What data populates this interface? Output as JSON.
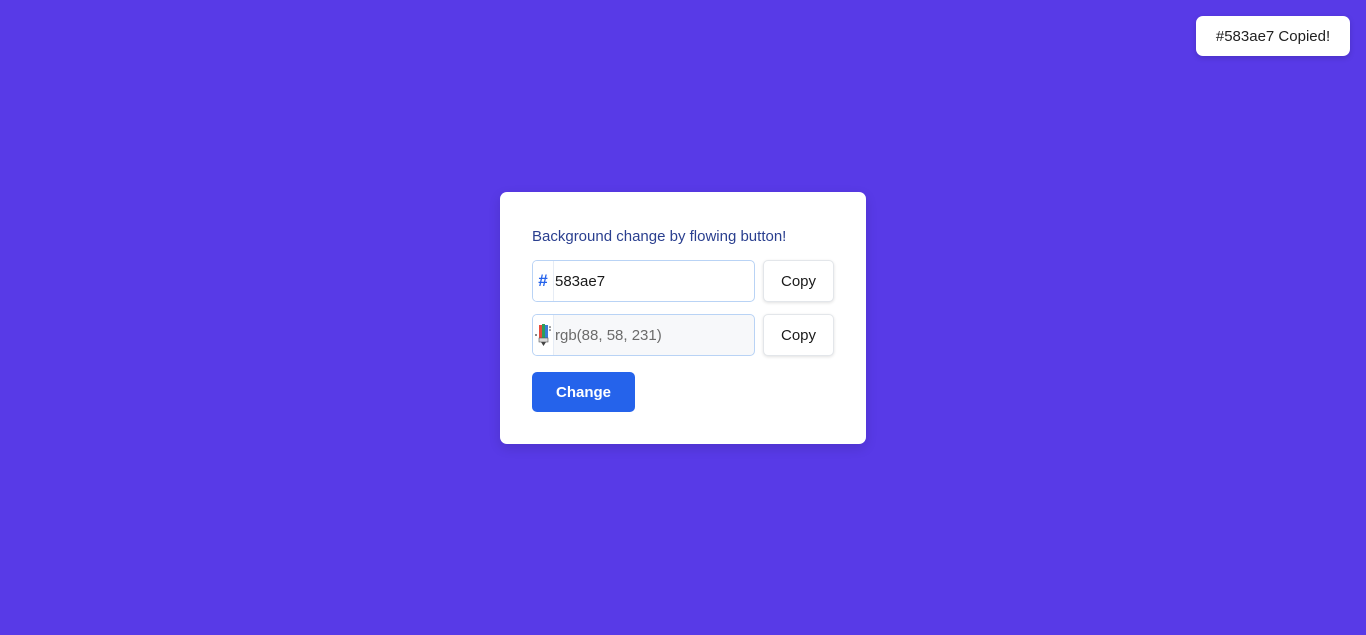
{
  "background_color": "#583ae7",
  "toast": {
    "message": "#583ae7 Copied!"
  },
  "card": {
    "subtitle": "Background change by flowing button!",
    "hex_row": {
      "prefix_symbol": "#",
      "prefix_icon": "hash-icon",
      "value": "583ae7",
      "copy_label": "Copy"
    },
    "rgb_row": {
      "prefix_icon": "color-pencils-icon",
      "value": "rgb(88, 58, 231)",
      "copy_label": "Copy"
    },
    "change_label": "Change"
  },
  "colors": {
    "primary": "#2563eb",
    "card_bg": "#ffffff",
    "subtitle": "#2a3f8f"
  }
}
